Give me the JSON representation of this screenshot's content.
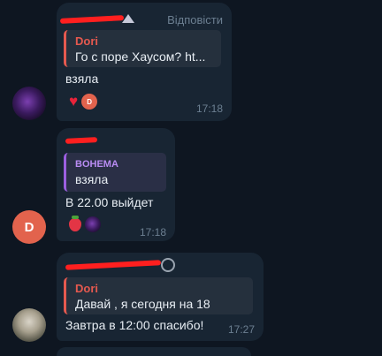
{
  "messages": [
    {
      "reply_button": "Відповісти",
      "quote": {
        "name": "Dori",
        "text": "Го с поре Хаусом?  ht..."
      },
      "text": "взяла",
      "reactions": [
        "heart",
        "D"
      ],
      "time": "17:18"
    },
    {
      "quote": {
        "name": "BOHEMA",
        "text": "взяла"
      },
      "text": "В 22.00 выйдет",
      "reactions": [
        "strawberry",
        "avatar"
      ],
      "time": "17:18"
    },
    {
      "quote": {
        "name": "Dori",
        "text": "Давай , я сегодня на 18"
      },
      "text": "Завтра в 12:00 спасибо!",
      "time": "17:27"
    }
  ],
  "avatars": {
    "d_letter": "D"
  },
  "colors": {
    "background": "#0e1621",
    "bubble": "#182533",
    "accent_red": "#e5594f",
    "accent_purple": "#9c5fe0",
    "muted": "#6c7f91"
  }
}
